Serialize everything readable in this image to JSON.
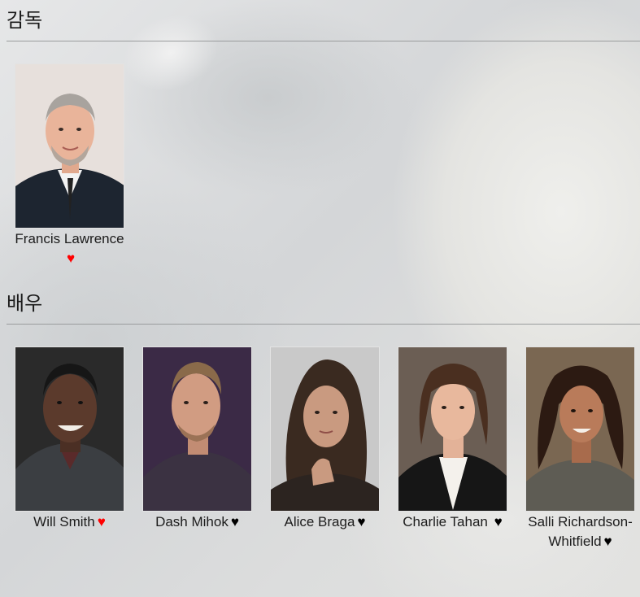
{
  "director_section": {
    "title": "감독",
    "people": [
      {
        "name": "Francis Lawrence",
        "favorite": true,
        "heart_icon": "heart-icon"
      }
    ]
  },
  "actor_section": {
    "title": "배우",
    "people": [
      {
        "name": "Will Smith",
        "favorite": true,
        "heart_icon": "heart-icon"
      },
      {
        "name": "Dash Mihok",
        "favorite": false,
        "heart_icon": "heart-icon"
      },
      {
        "name": "Alice Braga",
        "favorite": false,
        "heart_icon": "heart-icon"
      },
      {
        "name": "Charlie Tahan",
        "favorite": false,
        "heart_icon": "heart-icon"
      },
      {
        "name": "Salli Richardson-Whitfield",
        "favorite": false,
        "heart_icon": "heart-icon"
      }
    ]
  },
  "colors": {
    "heart_active": "#ff0000",
    "heart_inactive": "#000000",
    "divider": "#9a9c9d"
  }
}
